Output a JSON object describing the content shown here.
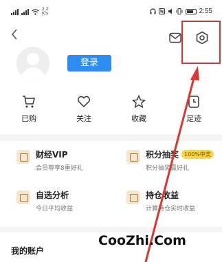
{
  "status_bar": {
    "left_text": "2.2\nK/s",
    "time": "2:55"
  },
  "header": {
    "back_icon": "chevron-left-icon",
    "mail_icon": "mail-icon",
    "settings_icon": "hexagon-settings-icon"
  },
  "profile": {
    "login_label": "登录"
  },
  "quick_actions": [
    {
      "label": "已购",
      "icon": "cart-icon"
    },
    {
      "label": "关注",
      "icon": "heart-icon"
    },
    {
      "label": "收藏",
      "icon": "star-icon"
    },
    {
      "label": "足迹",
      "icon": "footprint-icon"
    }
  ],
  "cards": {
    "vip": {
      "title": "财经VIP",
      "subtitle": "会员尊享8重好礼"
    },
    "lottery": {
      "title": "积分抽奖",
      "badge": "100%中奖",
      "subtitle": "积分抽奖赢好礼"
    },
    "analysis": {
      "title": "自选分析",
      "subtitle": "今日平均收益"
    },
    "holdings": {
      "title": "持仓收益",
      "subtitle": "计算持仓实时收益"
    }
  },
  "section": {
    "title": "我的账户"
  },
  "watermark": "CooZhi.Com",
  "colors": {
    "accent": "#2d8cf0",
    "annotation": "#e0332f",
    "badge": "#f7d64a"
  }
}
